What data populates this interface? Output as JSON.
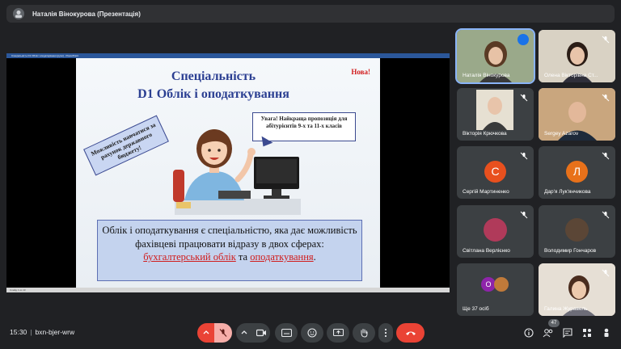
{
  "presenter": {
    "name": "Наталія Вінокурова (Презентація)"
  },
  "ppt": {
    "window_title": "Спеціальність D1 Облік і оподаткування (рухи) - PowerPoint",
    "slide_status": "Слайд 1 из 13"
  },
  "slide": {
    "title_line1": "Спеціальність",
    "title_line2": "D1 Облік і оподаткування",
    "new_tag": "Нова!",
    "funding_text": "Можливість навчатися за рахунок державного бюджету!",
    "speech_text": "Увага! Найкраща пропозиція для абітурієнтів 9-х та 11-х класів",
    "main_text": "Облік і оподаткування є спеціальністю, яка дає можливість фахівцеві працювати відразу в двох сферах:",
    "accent1": "бухгалтерський облік",
    "connector": "та",
    "accent2": "оподаткування",
    "period": "."
  },
  "participants": [
    {
      "name": "Наталія Вінокурова",
      "kind": "video",
      "speaking": true
    },
    {
      "name": "Олена Вікторівна Ст...",
      "kind": "video",
      "muted": true
    },
    {
      "name": "Вікторія Крючкова",
      "kind": "photo",
      "muted": true
    },
    {
      "name": "Sergey Azarov",
      "kind": "video",
      "muted": true
    },
    {
      "name": "Сергій Мартиненко",
      "kind": "letter",
      "letter": "С",
      "color": "#e8501e",
      "muted": true
    },
    {
      "name": "Дар'я Лук'янчикова",
      "kind": "letter",
      "letter": "Л",
      "color": "#e8711a",
      "muted": true
    },
    {
      "name": "Світлана Верлієнко",
      "kind": "photo",
      "muted": true
    },
    {
      "name": "Володимир Гончаров",
      "kind": "photo",
      "muted": true
    },
    {
      "name": "Ще 37 осіб",
      "kind": "more",
      "letter": "О",
      "color": "#8e24aa"
    },
    {
      "name": "Галина Журавель",
      "kind": "video",
      "muted": true
    }
  ],
  "meeting": {
    "time": "15:30",
    "code": "bxn-bjer-wrw",
    "people_count": "47"
  },
  "colors": {
    "accent": "#8ab4f8",
    "leave": "#ea4335",
    "mic_off": "#f6aea9",
    "tile_bg": "#3c4043"
  }
}
